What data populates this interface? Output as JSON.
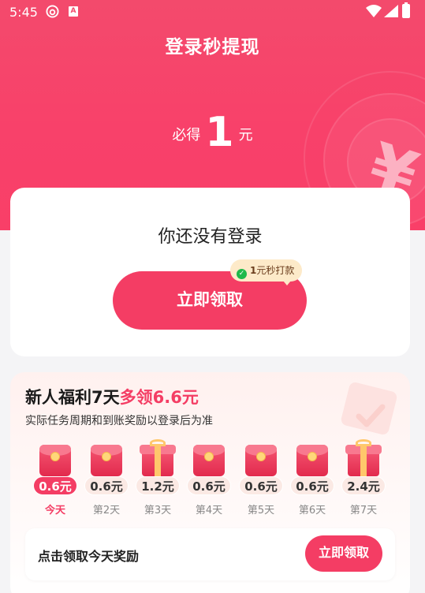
{
  "status_bar": {
    "time": "5:45",
    "app_icon_letter": "A"
  },
  "header": {
    "title": "登录秒提现"
  },
  "reward": {
    "prefix": "必得",
    "amount": "1",
    "unit": "元"
  },
  "login_card": {
    "message": "你还没有登录",
    "button_label": "立即领取",
    "tag": {
      "amount": "1",
      "text": "元秒打款"
    }
  },
  "welfare": {
    "title_main": "新人福利7天",
    "title_highlight": "多领6.6元",
    "subtitle": "实际任务周期和到账奖励以登录后为准",
    "days": [
      {
        "value": "0.6元",
        "label": "今天",
        "icon": "red-envelope-icon",
        "today": true
      },
      {
        "value": "0.6元",
        "label": "第2天",
        "icon": "red-envelope-icon",
        "today": false
      },
      {
        "value": "1.2元",
        "label": "第3天",
        "icon": "gift-box-icon",
        "today": false
      },
      {
        "value": "0.6元",
        "label": "第4天",
        "icon": "red-envelope-icon",
        "today": false
      },
      {
        "value": "0.6元",
        "label": "第5天",
        "icon": "red-envelope-icon",
        "today": false
      },
      {
        "value": "0.6元",
        "label": "第6天",
        "icon": "red-envelope-icon",
        "today": false
      },
      {
        "value": "2.4元",
        "label": "第7天",
        "icon": "gift-box-icon",
        "today": false
      }
    ],
    "bottom_text": "点击领取今天奖励",
    "bottom_button_label": "立即领取"
  },
  "colors": {
    "brand": "#f43d64",
    "hero": "#f8416a",
    "tag_bg": "#fdeac9",
    "wechat_green": "#1fb94b"
  }
}
